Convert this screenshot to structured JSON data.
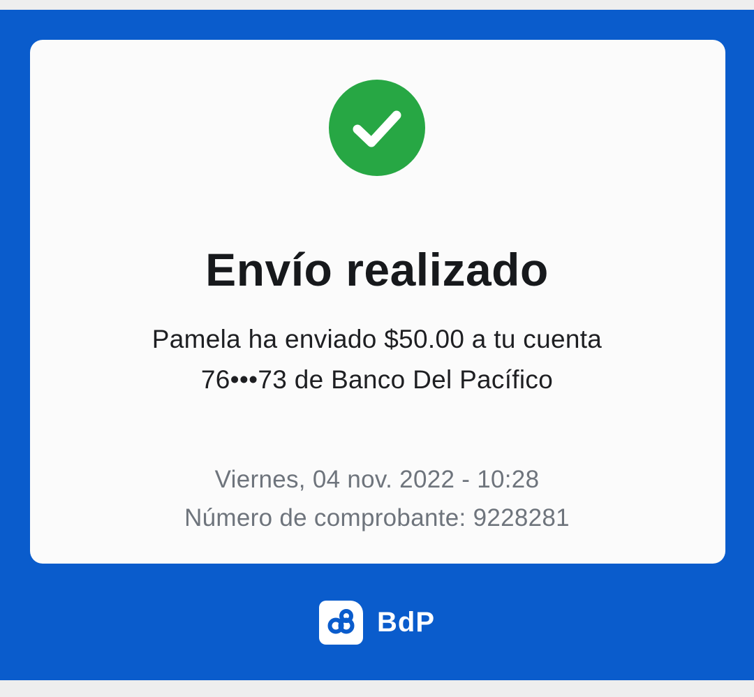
{
  "receipt": {
    "title": "Envío realizado",
    "message_line1": "Pamela ha enviado $50.00 a tu cuenta",
    "message_line2": "76•••73 de Banco Del Pacífico",
    "date_time": "Viernes, 04 nov. 2022 - 10:28",
    "receipt_number": "Número de comprobante: 9228281",
    "status_icon": "check-icon"
  },
  "brand": {
    "name": "BdP",
    "logo_icon": "bdp-logo-icon"
  },
  "colors": {
    "brand_blue": "#0a5ccc",
    "success_green": "#27a744",
    "card_background": "#fbfbfb",
    "title_text": "#17191c",
    "meta_text": "#6e747c"
  }
}
